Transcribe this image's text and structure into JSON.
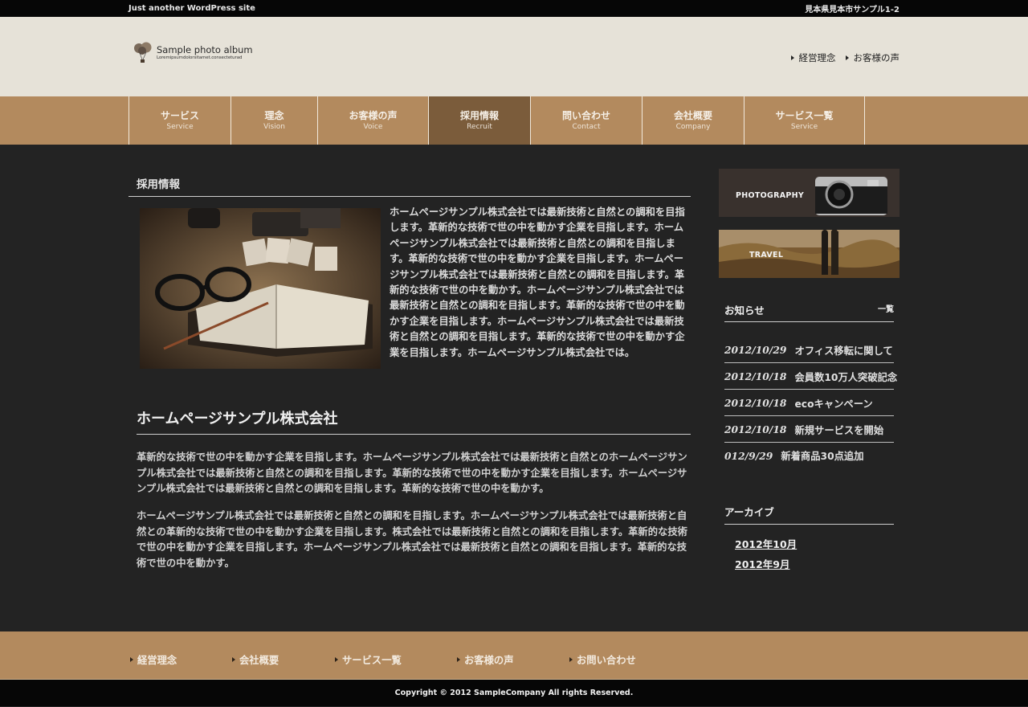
{
  "topbar": {
    "tagline": "Just another WordPress site",
    "address": "見本県見本市サンプル1-2"
  },
  "header": {
    "logo_title": "Sample photo album",
    "logo_subtitle": "Loremipsumdolorsitamet.consecteturad",
    "links": [
      "経営理念",
      "お客様の声"
    ]
  },
  "nav": [
    {
      "jp": "サービス",
      "en": "Service"
    },
    {
      "jp": "理念",
      "en": "Vision"
    },
    {
      "jp": "お客様の声",
      "en": "Voice"
    },
    {
      "jp": "採用情報",
      "en": "Recruit"
    },
    {
      "jp": "問い合わせ",
      "en": "Contact"
    },
    {
      "jp": "会社概要",
      "en": "Company"
    },
    {
      "jp": "サービス一覧",
      "en": "Service"
    }
  ],
  "main": {
    "section_title": "採用情報",
    "intro": "ホームページサンプル株式会社では最新技術と自然との調和を目指します。革新的な技術で世の中を動かす企業を目指します。ホームページサンプル株式会社では最新技術と自然との調和を目指します。革新的な技術で世の中を動かす企業を目指します。ホームページサンプル株式会社では最新技術と自然との調和を目指します。革新的な技術で世の中を動かす。ホームページサンプル株式会社では最新技術と自然との調和を目指します。革新的な技術で世の中を動かす企業を目指します。ホームページサンプル株式会社では最新技術と自然との調和を目指します。革新的な技術で世の中を動かす企業を目指します。ホームページサンプル株式会社では。",
    "company_heading": "ホームページサンプル株式会社",
    "para1": "革新的な技術で世の中を動かす企業を目指します。ホームページサンプル株式会社では最新技術と自然とのホームページサンプル株式会社では最新技術と自然との調和を目指します。革新的な技術で世の中を動かす企業を目指します。ホームページサンプル株式会社では最新技術と自然との調和を目指します。革新的な技術で世の中を動かす。",
    "para2": "ホームページサンプル株式会社では最新技術と自然との調和を目指します。ホームページサンプル株式会社では最新技術と自然との革新的な技術で世の中を動かす企業を目指します。株式会社では最新技術と自然との調和を目指します。革新的な技術で世の中を動かす企業を目指します。ホームページサンプル株式会社では最新技術と自然との調和を目指します。革新的な技術で世の中を動かす。"
  },
  "sidebar": {
    "banner1": "PHOTOGRAPHY",
    "banner2": "TRAVEL",
    "news_title": "お知らせ",
    "news_all": "一覧",
    "news": [
      {
        "date": "2012/10/29",
        "title": "オフィス移転に関して"
      },
      {
        "date": "2012/10/18",
        "title": "会員数10万人突破記念"
      },
      {
        "date": "2012/10/18",
        "title": "ecoキャンペーン"
      },
      {
        "date": "2012/10/18",
        "title": "新規サービスを開始"
      },
      {
        "date": "012/9/29",
        "title": "新着商品30点追加"
      }
    ],
    "archive_title": "アーカイブ",
    "archives": [
      "2012年10月",
      "2012年9月"
    ]
  },
  "footer": {
    "links": [
      "経営理念",
      "会社概要",
      "サービス一覧",
      "お客様の声",
      "お問い合わせ"
    ],
    "copyright": "Copyright © 2012 SampleCompany All rights Reserved."
  },
  "colors": {
    "nav": "#b38a5e",
    "nav_active": "#7b5c3b",
    "header_bg": "#e6e2d8",
    "body_bg": "#232323"
  }
}
